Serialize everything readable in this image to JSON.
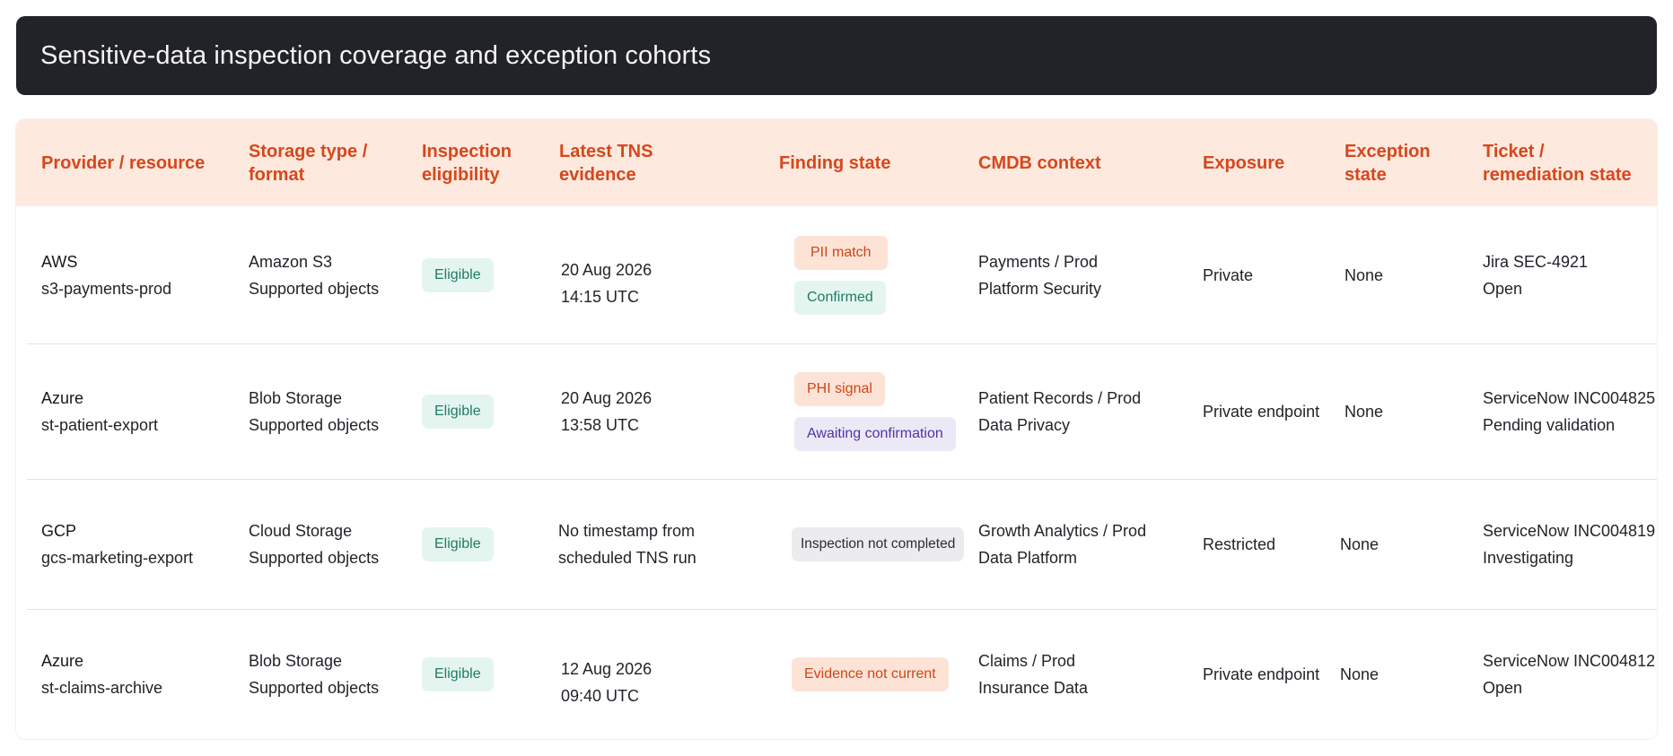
{
  "page": {
    "title": "Sensitive-data inspection coverage and exception cohorts"
  },
  "table": {
    "columns": [
      "Provider / resource",
      "Storage type / format",
      "Inspection eligibility",
      "Latest TNS evidence",
      "Finding state",
      "CMDB context",
      "Exposure",
      "Exception state",
      "Ticket / remediation state"
    ],
    "rows": [
      {
        "provider": "AWS",
        "resource": "s3-payments-prod",
        "storage_type": "Amazon S3",
        "format": "Supported objects",
        "eligibility": "Eligible",
        "evidence_line1": "20 Aug 2026",
        "evidence_line2": "14:15 UTC",
        "finding_primary": "PII match",
        "finding_secondary": "Confirmed",
        "cmdb_line1": "Payments / Prod",
        "cmdb_line2": "Platform Security",
        "exposure": "Private",
        "exception": "None",
        "ticket": "Jira SEC-4921",
        "remediation": "Open"
      },
      {
        "provider": "Azure",
        "resource": "st-patient-export",
        "storage_type": "Blob Storage",
        "format": "Supported objects",
        "eligibility": "Eligible",
        "evidence_line1": "20 Aug 2026",
        "evidence_line2": "13:58 UTC",
        "finding_primary": "PHI signal",
        "finding_secondary": "Awaiting confirmation",
        "cmdb_line1": "Patient Records / Prod",
        "cmdb_line2": "Data Privacy",
        "exposure": "Private endpoint",
        "exception": "None",
        "ticket": "ServiceNow INC004825",
        "remediation": "Pending validation"
      },
      {
        "provider": "GCP",
        "resource": "gcs-marketing-export",
        "storage_type": "Cloud Storage",
        "format": "Supported objects",
        "eligibility": "Eligible",
        "evidence_line1": "No timestamp from",
        "evidence_line2": "scheduled TNS run",
        "finding_primary": "Inspection not completed",
        "cmdb_line1": "Growth Analytics / Prod",
        "cmdb_line2": "Data Platform",
        "exposure": "Restricted",
        "exception": "None",
        "ticket": "ServiceNow INC004819",
        "remediation": "Investigating"
      },
      {
        "provider": "Azure",
        "resource": "st-claims-archive",
        "storage_type": "Blob Storage",
        "format": "Supported objects",
        "eligibility": "Eligible",
        "evidence_line1": "12 Aug 2026",
        "evidence_line2": "09:40 UTC",
        "finding_primary": "Evidence not current",
        "cmdb_line1": "Claims / Prod",
        "cmdb_line2": "Insurance Data",
        "exposure": "Private endpoint",
        "exception": "None",
        "ticket": "ServiceNow INC004812",
        "remediation": "Open"
      }
    ]
  },
  "colors": {
    "title_bar": "#212328",
    "header_bg": "#fde9de",
    "header_text": "#d7471c",
    "badge_green": "#e4f5f0",
    "badge_orange": "#fde3d6",
    "badge_purple": "#ebe9f5",
    "badge_gray": "#ececee"
  }
}
